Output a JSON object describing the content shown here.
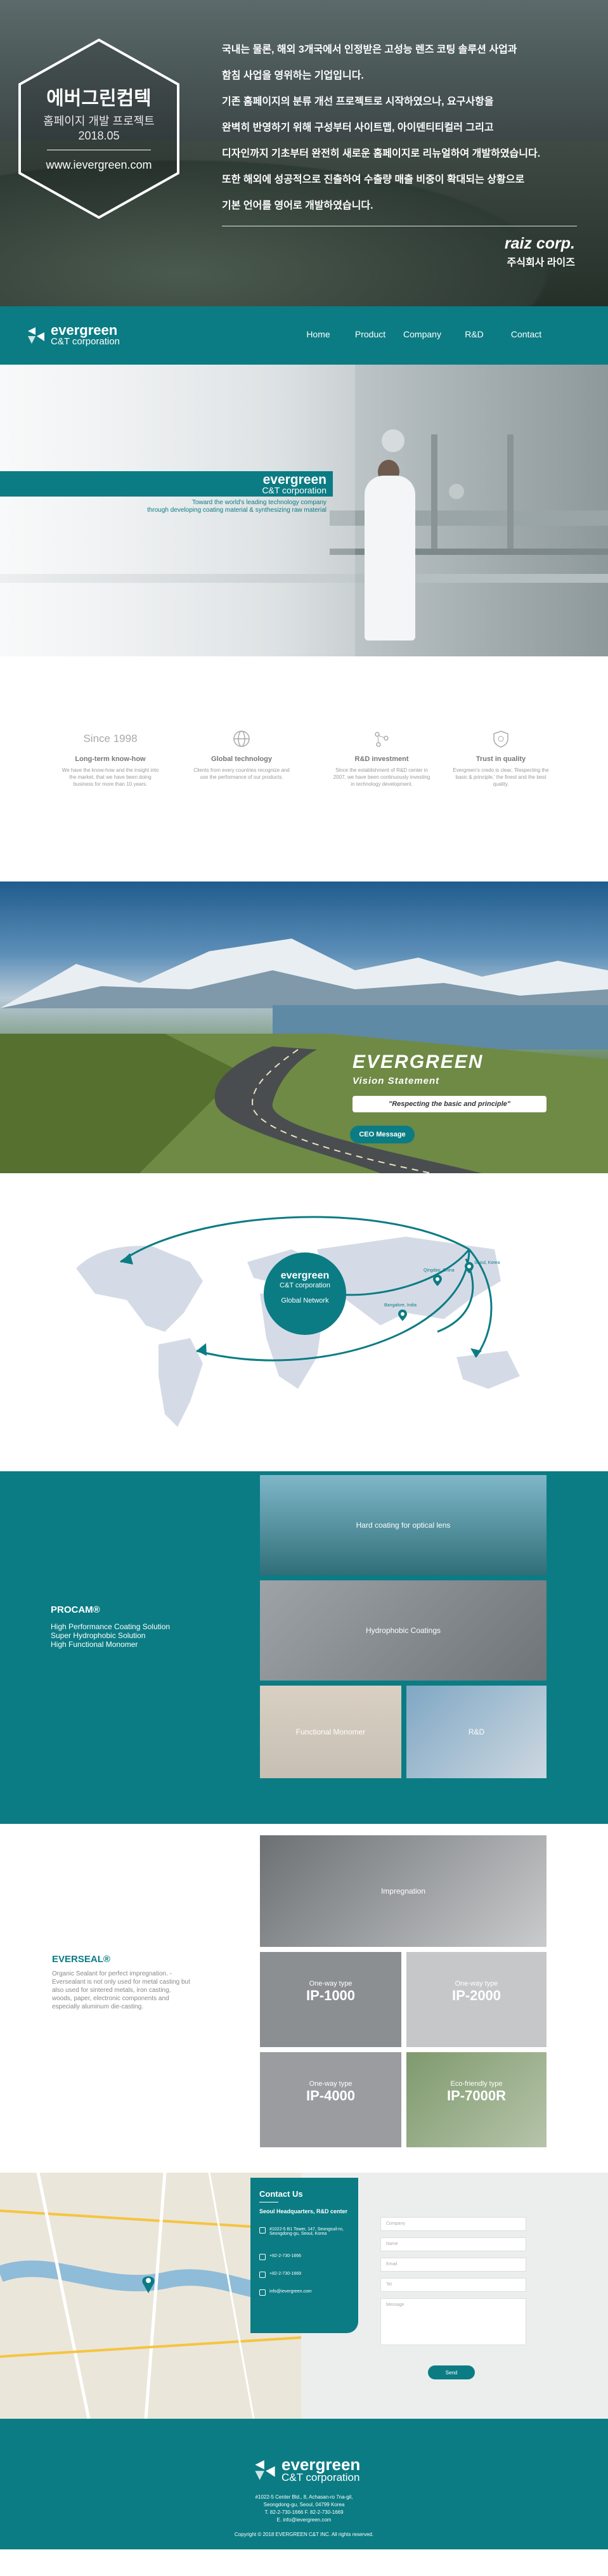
{
  "hero": {
    "title_kr": "에버그린컴텍",
    "subtitle_line1": "홈페이지 개발 프로젝트",
    "subtitle_line2": "2018.05",
    "url": "www.ievergreen.com",
    "description": [
      "국내는 물론, 해외 3개국에서 인정받은 고성능 렌즈 코팅 솔루션 사업과",
      "함침 사업을 영위하는 기업입니다.",
      "기존 홈페이지의 분류 개선 프로젝트로 시작하였으나, 요구사항을",
      "완벽히 반영하기 위해 구성부터 사이트맵, 아이덴티티컬러 그리고",
      "디자인까지 기초부터 완전히 새로운 홈페이지로 리뉴얼하여 개발하였습니다.",
      "또한 해외에 성공적으로 진출하여 수출량 매출 비중이 확대되는 상황으로",
      "기본 언어를 영어로 개발하였습니다."
    ],
    "agency": "raiz corp.",
    "agency_kr": "주식회사 라이즈"
  },
  "nav": {
    "logo_main": "evergreen",
    "logo_sub": "C&T corporation",
    "menu": [
      "Home",
      "Product",
      "Company",
      "R&D",
      "Contact"
    ]
  },
  "lab": {
    "brand": "evergreen",
    "brand_sub": "C&T corporation",
    "tagline1": "Toward the world's leading technology company",
    "tagline2": "through developing coating material & synthesizing raw material"
  },
  "features": [
    {
      "icon": "since-text",
      "icon_text": "Since 1998",
      "title": "Long-term know-how",
      "text": "We have the know-how and the insight into the market, that we have been doing business for more than 10 years."
    },
    {
      "icon": "globe-icon",
      "icon_text": "",
      "title": "Global technology",
      "text": "Clients from every countries recognize and use the performance of our products."
    },
    {
      "icon": "molecule-icon",
      "icon_text": "",
      "title": "R&D investment",
      "text": "Since the establishment of R&D center in 2007, we have been continuously investing in technology development."
    },
    {
      "icon": "shield-icon",
      "icon_text": "",
      "title": "Trust in quality",
      "text": "Evergreen's credo is clear, 'Respecting the basic & principle,' the finest and the best quality."
    }
  ],
  "vision": {
    "brand": "EVERGREEN",
    "label": "Vision Statement",
    "motto": "\"Respecting the basic and principle\"",
    "button": "CEO Message"
  },
  "map": {
    "brand": "evergreen",
    "brand_sub": "C&T corporation",
    "label": "Global Network",
    "pins": [
      "Seoul, Korea",
      "Qingdao, China",
      "Bangalore, India"
    ]
  },
  "procam": {
    "label": "PROCAM®",
    "items": [
      "High Performance Coating Solution",
      "Super Hydrophobic Solution",
      "High Functional Monomer"
    ],
    "tiles": [
      "Hard coating for optical lens",
      "Hydrophobic Coatings",
      "Functional Monomer",
      "R&D"
    ]
  },
  "everseal": {
    "label": "EVERSEAL®",
    "description": "Organic Sealant for perfect impregnation. - Eversealant is not only used for metal casting but also used for sintered metals, iron casting, woods, paper, electronic components and especially aluminum die-casting.",
    "top_tile": "Impregnation",
    "tiles": [
      {
        "small": "One-way type",
        "big": "IP-1000"
      },
      {
        "small": "One-way type",
        "big": "IP-2000"
      },
      {
        "small": "One-way type",
        "big": "IP-4000"
      },
      {
        "small": "Eco-friendly type",
        "big": "IP-7000R"
      }
    ]
  },
  "contact": {
    "title": "Contact Us",
    "office": "Seoul Headquarters, R&D center",
    "address": "#1022-5 B1 Tower, 147, Seongsuil-ro, Seongdong-gu, Seoul, Korea",
    "phone": "+82-2-730-1666",
    "fax": "+82-2-730-1669",
    "email": "info@ievergreen.com",
    "fields": [
      "Company",
      "Name",
      "Email",
      "Tel",
      "Message"
    ],
    "send": "Send"
  },
  "footer": {
    "logo_main": "evergreen",
    "logo_sub": "C&T corporation",
    "address_lines": [
      "#1022-5 Center Bld., 8, Achasan-ro 7na-gil,",
      "Seongdong-gu, Seoul, 04799 Korea",
      "T. 82-2-730-1666 F. 82-2-730-1669",
      "E. info@ievergreen.com"
    ],
    "copyright": "Copyright © 2018 EVERGREEN C&T INC. All rights reserved."
  },
  "colors": {
    "accent": "#0b7c84"
  }
}
